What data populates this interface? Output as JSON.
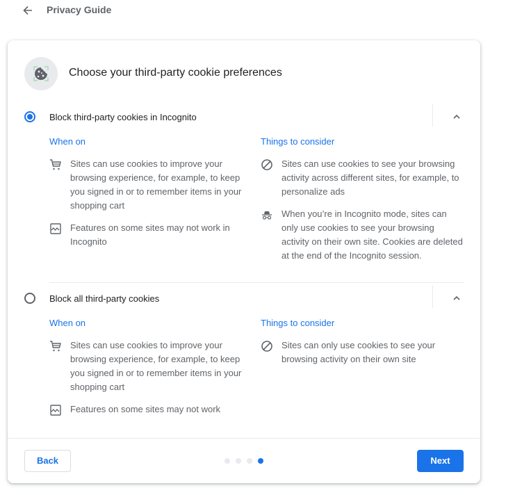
{
  "header": {
    "title": "Privacy Guide",
    "back_icon": "arrow-back-icon"
  },
  "card": {
    "title": "Choose your third-party cookie preferences",
    "header_icon": "cookie-icon",
    "options": [
      {
        "label": "Block third-party cookies in Incognito",
        "selected": true,
        "expanded": true,
        "when_on_heading": "When on",
        "consider_heading": "Things to consider",
        "when_on": [
          {
            "icon": "shopping-cart-icon",
            "text": "Sites can use cookies to improve your browsing experience, for example, to keep you signed in or to remember items in your shopping cart"
          },
          {
            "icon": "broken-page-icon",
            "text": "Features on some sites may not work in Incognito"
          }
        ],
        "consider": [
          {
            "icon": "block-icon",
            "text": "Sites can use cookies to see your browsing activity across different sites, for example, to personalize ads"
          },
          {
            "icon": "incognito-icon",
            "text": "When you’re in Incognito mode, sites can only use cookies to see your browsing activity on their own site. Cookies are deleted at the end of the Incognito session."
          }
        ]
      },
      {
        "label": "Block all third-party cookies",
        "selected": false,
        "expanded": true,
        "when_on_heading": "When on",
        "consider_heading": "Things to consider",
        "when_on": [
          {
            "icon": "shopping-cart-icon",
            "text": "Sites can use cookies to improve your browsing experience, for example, to keep you signed in or to remember items in your shopping cart"
          },
          {
            "icon": "broken-page-icon",
            "text": "Features on some sites may not work"
          }
        ],
        "consider": [
          {
            "icon": "block-icon",
            "text": "Sites can only use cookies to see your browsing activity on their own site"
          }
        ]
      }
    ]
  },
  "footer": {
    "back_label": "Back",
    "next_label": "Next",
    "steps_total": 4,
    "current_step": 4
  },
  "colors": {
    "accent": "#1a73e8",
    "text_primary": "#202124",
    "text_secondary": "#5f6368",
    "divider": "#e8eaed"
  }
}
